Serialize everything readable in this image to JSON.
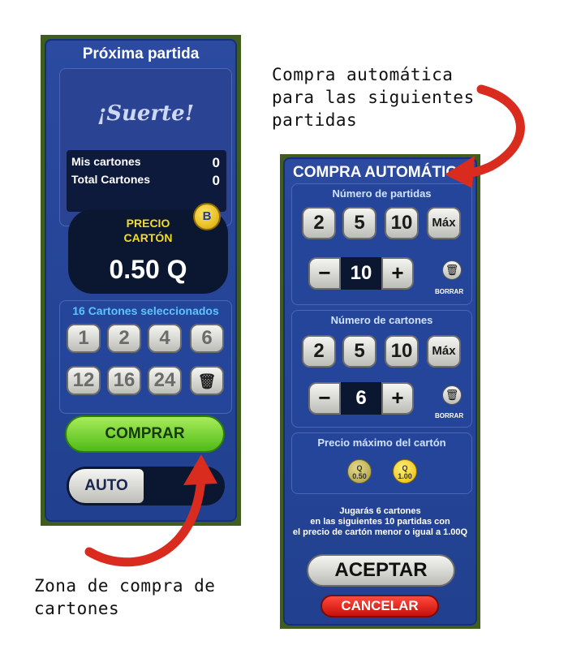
{
  "left_panel": {
    "title": "Próxima partida",
    "luck_text": "¡Suerte!",
    "mis_cartones_label": "Mis cartones",
    "mis_cartones_value": "0",
    "total_cartones_label": "Total Cartones",
    "total_cartones_value": "0",
    "precio_label_line1": "PRECIO",
    "precio_label_line2": "CARTÓN",
    "precio_value": "0.50 Q",
    "coin_letter": "B",
    "selected_title": "16 Cartones seleccionados",
    "card_counts": [
      "1",
      "2",
      "4",
      "6",
      "12",
      "16",
      "24"
    ],
    "comprar_label": "COMPRAR",
    "auto_label": "AUTO"
  },
  "right_panel": {
    "title": "COMPRA AUTOMÁTICA",
    "partidas": {
      "title": "Número de partidas",
      "options": [
        "2",
        "5",
        "10",
        "Máx"
      ],
      "value": "10",
      "borrar_label": "BORRAR"
    },
    "cartones": {
      "title": "Número de cartones",
      "options": [
        "2",
        "5",
        "10",
        "Máx"
      ],
      "value": "6",
      "borrar_label": "BORRAR"
    },
    "precio_maximo": {
      "title": "Precio máximo del cartón",
      "coin1_top": "Q",
      "coin1_bottom": "0.50",
      "coin2_top": "Q",
      "coin2_bottom": "1.00"
    },
    "summary_line1": "Jugarás 6 cartones",
    "summary_line2": "en las siguientes 10 partidas con",
    "summary_line3": "el precio de cartón menor o igual a 1.00Q",
    "aceptar_label": "ACEPTAR",
    "cancelar_label": "CANCELAR"
  },
  "annotations": {
    "right_line1": "Compra automática",
    "right_line2": "para las siguientes",
    "right_line3": "partidas",
    "left_line1": "Zona de compra de",
    "left_line2": "cartones"
  },
  "colors": {
    "panel_blue": "#2b4aa0",
    "frame_green": "#3f5d1f",
    "arrow_red": "#d92b1e",
    "comprar_green": "#6fd12a",
    "cancel_red": "#e0241a",
    "precio_yellow": "#f3dc27"
  }
}
